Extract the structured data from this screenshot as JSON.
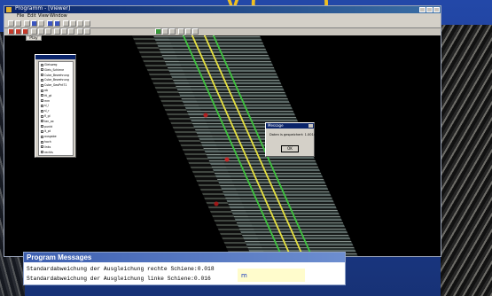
{
  "slide": {
    "title_fragment": "y ( . . . )",
    "colors": {
      "background": "#1d3f93",
      "title": "#f0c020"
    }
  },
  "window": {
    "title": "Programm - [Viewer]",
    "icon": "app-icon",
    "controls": [
      "minimize-icon",
      "maximize-icon",
      "close-icon"
    ],
    "menu": [
      "File",
      "Edit",
      "View",
      "Window"
    ],
    "play_label": "Play"
  },
  "tree": {
    "items": [
      "Gleisweg",
      "Gleis_Schiene",
      "Cube_Bewehrung",
      "Cube_Bewehrung",
      "Cube_GeoPnt71",
      "ab",
      "Hi_gt",
      "mm",
      "sl_l",
      "sl_r",
      "fl_gl",
      "tan_ax",
      "punkt",
      "lt_pt",
      "ausgabe",
      "hoch",
      "links",
      "rechts"
    ]
  },
  "message": {
    "title": "Message",
    "text": "Daten is gespeichert: 1.0014",
    "ok_label": "OK"
  },
  "program_messages": {
    "title": "Program Messages",
    "lines": [
      "Standardabweichung der Ausgleichung rechte Schiene:0.018",
      "Standardabweichung der Ausgleichung linke  Schiene:0.016"
    ],
    "unit": "m"
  }
}
